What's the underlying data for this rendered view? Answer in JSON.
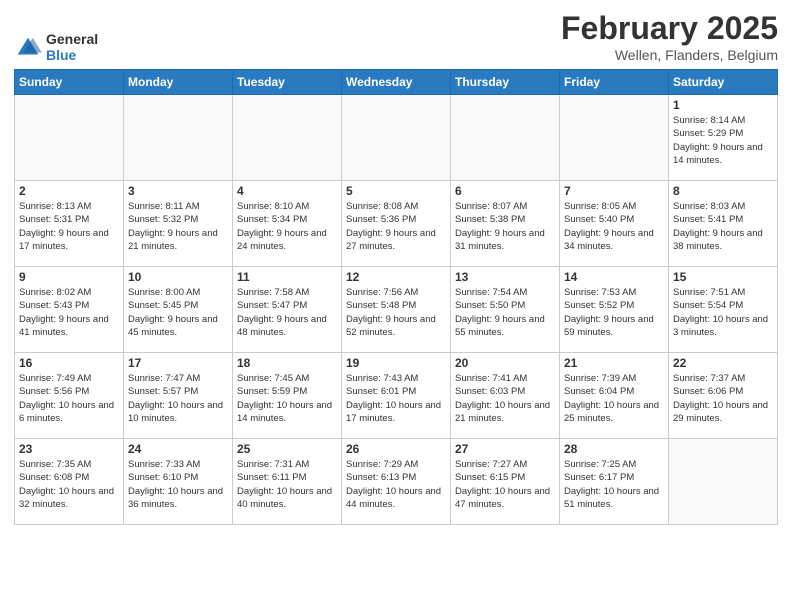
{
  "header": {
    "logo_general": "General",
    "logo_blue": "Blue",
    "month_title": "February 2025",
    "subtitle": "Wellen, Flanders, Belgium"
  },
  "days_of_week": [
    "Sunday",
    "Monday",
    "Tuesday",
    "Wednesday",
    "Thursday",
    "Friday",
    "Saturday"
  ],
  "weeks": [
    [
      {
        "day": "",
        "info": ""
      },
      {
        "day": "",
        "info": ""
      },
      {
        "day": "",
        "info": ""
      },
      {
        "day": "",
        "info": ""
      },
      {
        "day": "",
        "info": ""
      },
      {
        "day": "",
        "info": ""
      },
      {
        "day": "1",
        "info": "Sunrise: 8:14 AM\nSunset: 5:29 PM\nDaylight: 9 hours\nand 14 minutes."
      }
    ],
    [
      {
        "day": "2",
        "info": "Sunrise: 8:13 AM\nSunset: 5:31 PM\nDaylight: 9 hours\nand 17 minutes."
      },
      {
        "day": "3",
        "info": "Sunrise: 8:11 AM\nSunset: 5:32 PM\nDaylight: 9 hours\nand 21 minutes."
      },
      {
        "day": "4",
        "info": "Sunrise: 8:10 AM\nSunset: 5:34 PM\nDaylight: 9 hours\nand 24 minutes."
      },
      {
        "day": "5",
        "info": "Sunrise: 8:08 AM\nSunset: 5:36 PM\nDaylight: 9 hours\nand 27 minutes."
      },
      {
        "day": "6",
        "info": "Sunrise: 8:07 AM\nSunset: 5:38 PM\nDaylight: 9 hours\nand 31 minutes."
      },
      {
        "day": "7",
        "info": "Sunrise: 8:05 AM\nSunset: 5:40 PM\nDaylight: 9 hours\nand 34 minutes."
      },
      {
        "day": "8",
        "info": "Sunrise: 8:03 AM\nSunset: 5:41 PM\nDaylight: 9 hours\nand 38 minutes."
      }
    ],
    [
      {
        "day": "9",
        "info": "Sunrise: 8:02 AM\nSunset: 5:43 PM\nDaylight: 9 hours\nand 41 minutes."
      },
      {
        "day": "10",
        "info": "Sunrise: 8:00 AM\nSunset: 5:45 PM\nDaylight: 9 hours\nand 45 minutes."
      },
      {
        "day": "11",
        "info": "Sunrise: 7:58 AM\nSunset: 5:47 PM\nDaylight: 9 hours\nand 48 minutes."
      },
      {
        "day": "12",
        "info": "Sunrise: 7:56 AM\nSunset: 5:48 PM\nDaylight: 9 hours\nand 52 minutes."
      },
      {
        "day": "13",
        "info": "Sunrise: 7:54 AM\nSunset: 5:50 PM\nDaylight: 9 hours\nand 55 minutes."
      },
      {
        "day": "14",
        "info": "Sunrise: 7:53 AM\nSunset: 5:52 PM\nDaylight: 9 hours\nand 59 minutes."
      },
      {
        "day": "15",
        "info": "Sunrise: 7:51 AM\nSunset: 5:54 PM\nDaylight: 10 hours\nand 3 minutes."
      }
    ],
    [
      {
        "day": "16",
        "info": "Sunrise: 7:49 AM\nSunset: 5:56 PM\nDaylight: 10 hours\nand 6 minutes."
      },
      {
        "day": "17",
        "info": "Sunrise: 7:47 AM\nSunset: 5:57 PM\nDaylight: 10 hours\nand 10 minutes."
      },
      {
        "day": "18",
        "info": "Sunrise: 7:45 AM\nSunset: 5:59 PM\nDaylight: 10 hours\nand 14 minutes."
      },
      {
        "day": "19",
        "info": "Sunrise: 7:43 AM\nSunset: 6:01 PM\nDaylight: 10 hours\nand 17 minutes."
      },
      {
        "day": "20",
        "info": "Sunrise: 7:41 AM\nSunset: 6:03 PM\nDaylight: 10 hours\nand 21 minutes."
      },
      {
        "day": "21",
        "info": "Sunrise: 7:39 AM\nSunset: 6:04 PM\nDaylight: 10 hours\nand 25 minutes."
      },
      {
        "day": "22",
        "info": "Sunrise: 7:37 AM\nSunset: 6:06 PM\nDaylight: 10 hours\nand 29 minutes."
      }
    ],
    [
      {
        "day": "23",
        "info": "Sunrise: 7:35 AM\nSunset: 6:08 PM\nDaylight: 10 hours\nand 32 minutes."
      },
      {
        "day": "24",
        "info": "Sunrise: 7:33 AM\nSunset: 6:10 PM\nDaylight: 10 hours\nand 36 minutes."
      },
      {
        "day": "25",
        "info": "Sunrise: 7:31 AM\nSunset: 6:11 PM\nDaylight: 10 hours\nand 40 minutes."
      },
      {
        "day": "26",
        "info": "Sunrise: 7:29 AM\nSunset: 6:13 PM\nDaylight: 10 hours\nand 44 minutes."
      },
      {
        "day": "27",
        "info": "Sunrise: 7:27 AM\nSunset: 6:15 PM\nDaylight: 10 hours\nand 47 minutes."
      },
      {
        "day": "28",
        "info": "Sunrise: 7:25 AM\nSunset: 6:17 PM\nDaylight: 10 hours\nand 51 minutes."
      },
      {
        "day": "",
        "info": ""
      }
    ]
  ]
}
